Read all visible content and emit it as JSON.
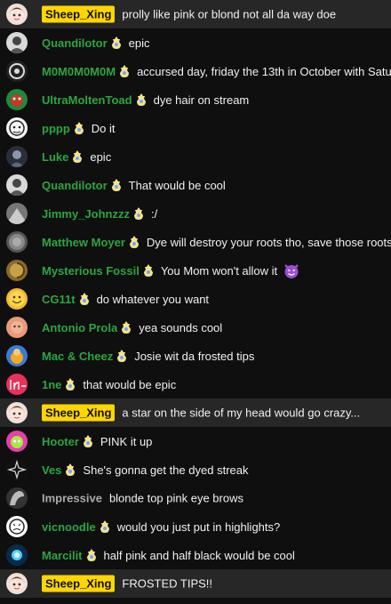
{
  "colors": {
    "background": "#0f0f0f",
    "highlight_row": "#272727",
    "owner_badge_bg": "#ffd600",
    "member_name": "#2ba640",
    "plain_name": "#aaaaaa",
    "message_text": "#f1f1f1"
  },
  "messages": [
    {
      "author": "Sheep_Xing",
      "text": "prolly like pink or blond not all da way doe",
      "owner": true
    },
    {
      "author": "Quandilotor",
      "text": "epic"
    },
    {
      "author": "M0M0M0M0M",
      "text": "accursed day, friday the 13th in October with Satu"
    },
    {
      "author": "UltraMoltenToad",
      "text": "dye hair on stream"
    },
    {
      "author": "pppp",
      "text": "Do it"
    },
    {
      "author": "Luke",
      "text": "epic"
    },
    {
      "author": "Quandilotor",
      "text": "That would be cool"
    },
    {
      "author": "Jimmy_Johnzzz",
      "text": ":/"
    },
    {
      "author": "Matthew Moyer",
      "text": "Dye will destroy your roots tho, save those roots"
    },
    {
      "author": "Mysterious Fossil",
      "text": "You Mom won't allow it",
      "emoji": "smiling-devil-emoji"
    },
    {
      "author": "CG11t",
      "text": "do whatever you want"
    },
    {
      "author": "Antonio Prola",
      "text": "yea sounds cool"
    },
    {
      "author": "Mac & Cheez",
      "text": "Josie wit da frosted tips"
    },
    {
      "author": "1ne",
      "text": "that would be epic"
    },
    {
      "author": "Sheep_Xing",
      "text": "a star on the side of my head would go crazy...",
      "owner": true
    },
    {
      "author": "Hooter",
      "text": "PINK it up"
    },
    {
      "author": "Ves",
      "text": "She's gonna get the dyed streak"
    },
    {
      "author": "Impressive",
      "text": "blonde top pink eye brows",
      "nonmember": true
    },
    {
      "author": "vicnoodle",
      "text": "would you just put in highlights?"
    },
    {
      "author": "Marcilit",
      "text": "half pink and half black would be cool"
    },
    {
      "author": "Sheep_Xing",
      "text": "FROSTED TIPS!!",
      "owner": true
    }
  ]
}
